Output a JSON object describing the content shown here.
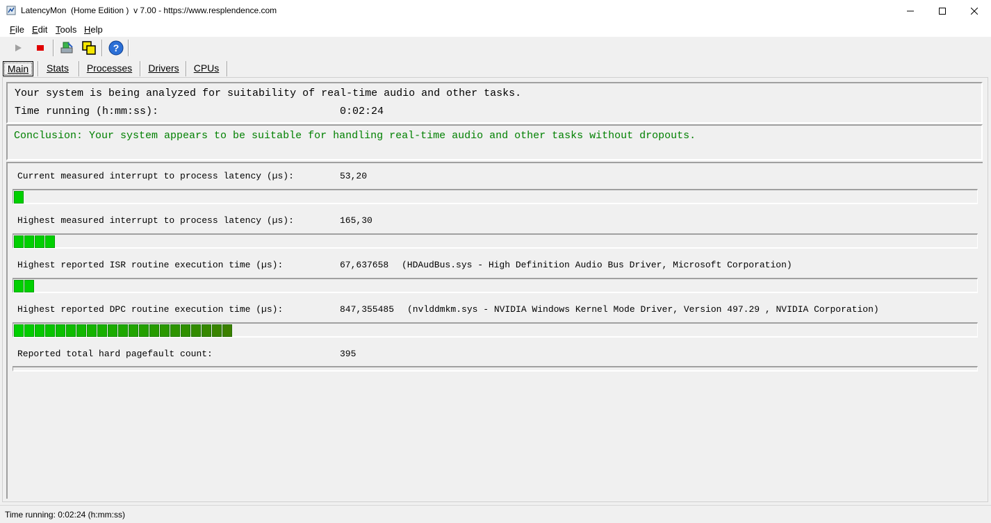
{
  "window": {
    "title": "LatencyMon  (Home Edition )  v 7.00 - https://www.resplendence.com",
    "minimize": "—",
    "maximize": "☐",
    "close": "✕"
  },
  "menu": [
    "File",
    "Edit",
    "Tools",
    "Help"
  ],
  "toolbar": {
    "play_icon": "play-icon",
    "stop_icon": "stop-icon",
    "drivers_icon": "drivers-icon",
    "windows_icon": "windows-icon",
    "help_icon": "help-icon"
  },
  "tabs": [
    "Main",
    "Stats",
    "Processes",
    "Drivers",
    "CPUs"
  ],
  "active_tab": "Main",
  "analysis": {
    "line1": "Your system is being analyzed for suitability of real-time audio and other tasks.",
    "time_label": "Time running (h:mm:ss):",
    "time_value": "0:02:24"
  },
  "conclusion": {
    "text": "Conclusion: Your system appears to be suitable for handling real-time audio and other tasks without dropouts.",
    "color": "#008000"
  },
  "metrics": [
    {
      "label": "Current measured interrupt to process latency (µs):",
      "value": "53,20",
      "detail": "",
      "segments": 1
    },
    {
      "label": "Highest measured interrupt to process latency (µs):",
      "value": "165,30",
      "detail": "",
      "segments": 4
    },
    {
      "label": "Highest reported ISR routine execution time (µs):",
      "value": "67,637658",
      "detail": "(HDAudBus.sys - High Definition Audio Bus Driver, Microsoft Corporation)",
      "segments": 2
    },
    {
      "label": "Highest reported DPC routine execution time (µs):",
      "value": "847,355485",
      "detail": "(nvlddmkm.sys - NVIDIA Windows Kernel Mode Driver, Version 497.29 , NVIDIA Corporation)",
      "segments": 21
    },
    {
      "label": "Reported total hard pagefault count:",
      "value": "395",
      "detail": "",
      "segments": 0
    }
  ],
  "status": {
    "text": "Time running: 0:02:24  (h:mm:ss)"
  },
  "colors": {
    "bar_green": "#00d000",
    "bar_dark_green": "#3c8c00"
  }
}
